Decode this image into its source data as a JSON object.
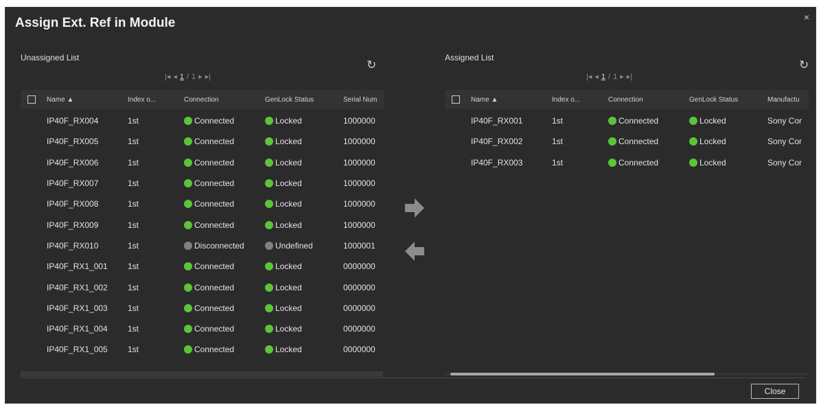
{
  "dialog": {
    "title": "Assign Ext. Ref in Module",
    "close_glyph": "×"
  },
  "colors": {
    "status_green": "#5cc43a",
    "status_gray": "#808080",
    "background": "#2b2b2b"
  },
  "left": {
    "title": "Unassigned List",
    "pager": {
      "page": "1",
      "sep": "/",
      "total": "1"
    },
    "columns": [
      "Name ▲",
      "Index o...",
      "Connection",
      "GenLock Status",
      "Serial Num"
    ],
    "rows": [
      {
        "name": "IP40F_RX004",
        "index": "1st",
        "connection": "Connected",
        "genlock": "Locked",
        "serial": "1000000",
        "ok": true
      },
      {
        "name": "IP40F_RX005",
        "index": "1st",
        "connection": "Connected",
        "genlock": "Locked",
        "serial": "1000000",
        "ok": true
      },
      {
        "name": "IP40F_RX006",
        "index": "1st",
        "connection": "Connected",
        "genlock": "Locked",
        "serial": "1000000",
        "ok": true
      },
      {
        "name": "IP40F_RX007",
        "index": "1st",
        "connection": "Connected",
        "genlock": "Locked",
        "serial": "1000000",
        "ok": true
      },
      {
        "name": "IP40F_RX008",
        "index": "1st",
        "connection": "Connected",
        "genlock": "Locked",
        "serial": "1000000",
        "ok": true
      },
      {
        "name": "IP40F_RX009",
        "index": "1st",
        "connection": "Connected",
        "genlock": "Locked",
        "serial": "1000000",
        "ok": true
      },
      {
        "name": "IP40F_RX010",
        "index": "1st",
        "connection": "Disconnected",
        "genlock": "Undefined",
        "serial": "1000001",
        "ok": false
      },
      {
        "name": "IP40F_RX1_001",
        "index": "1st",
        "connection": "Connected",
        "genlock": "Locked",
        "serial": "0000000",
        "ok": true
      },
      {
        "name": "IP40F_RX1_002",
        "index": "1st",
        "connection": "Connected",
        "genlock": "Locked",
        "serial": "0000000",
        "ok": true
      },
      {
        "name": "IP40F_RX1_003",
        "index": "1st",
        "connection": "Connected",
        "genlock": "Locked",
        "serial": "0000000",
        "ok": true
      },
      {
        "name": "IP40F_RX1_004",
        "index": "1st",
        "connection": "Connected",
        "genlock": "Locked",
        "serial": "0000000",
        "ok": true
      },
      {
        "name": "IP40F_RX1_005",
        "index": "1st",
        "connection": "Connected",
        "genlock": "Locked",
        "serial": "0000000",
        "ok": true
      }
    ]
  },
  "right": {
    "title": "Assigned List",
    "pager": {
      "page": "1",
      "sep": "/",
      "total": "1"
    },
    "columns": [
      "Name ▲",
      "Index o...",
      "Connection",
      "GenLock Status",
      "Manufactu"
    ],
    "rows": [
      {
        "name": "IP40F_RX001",
        "index": "1st",
        "connection": "Connected",
        "genlock": "Locked",
        "serial": "Sony Cor",
        "ok": true
      },
      {
        "name": "IP40F_RX002",
        "index": "1st",
        "connection": "Connected",
        "genlock": "Locked",
        "serial": "Sony Cor",
        "ok": true
      },
      {
        "name": "IP40F_RX003",
        "index": "1st",
        "connection": "Connected",
        "genlock": "Locked",
        "serial": "Sony Cor",
        "ok": true
      }
    ]
  },
  "icons": {
    "refresh": "refresh-icon",
    "assign": "arrow-right-icon",
    "unassign": "arrow-left-icon"
  },
  "buttons": {
    "close": "Close"
  }
}
